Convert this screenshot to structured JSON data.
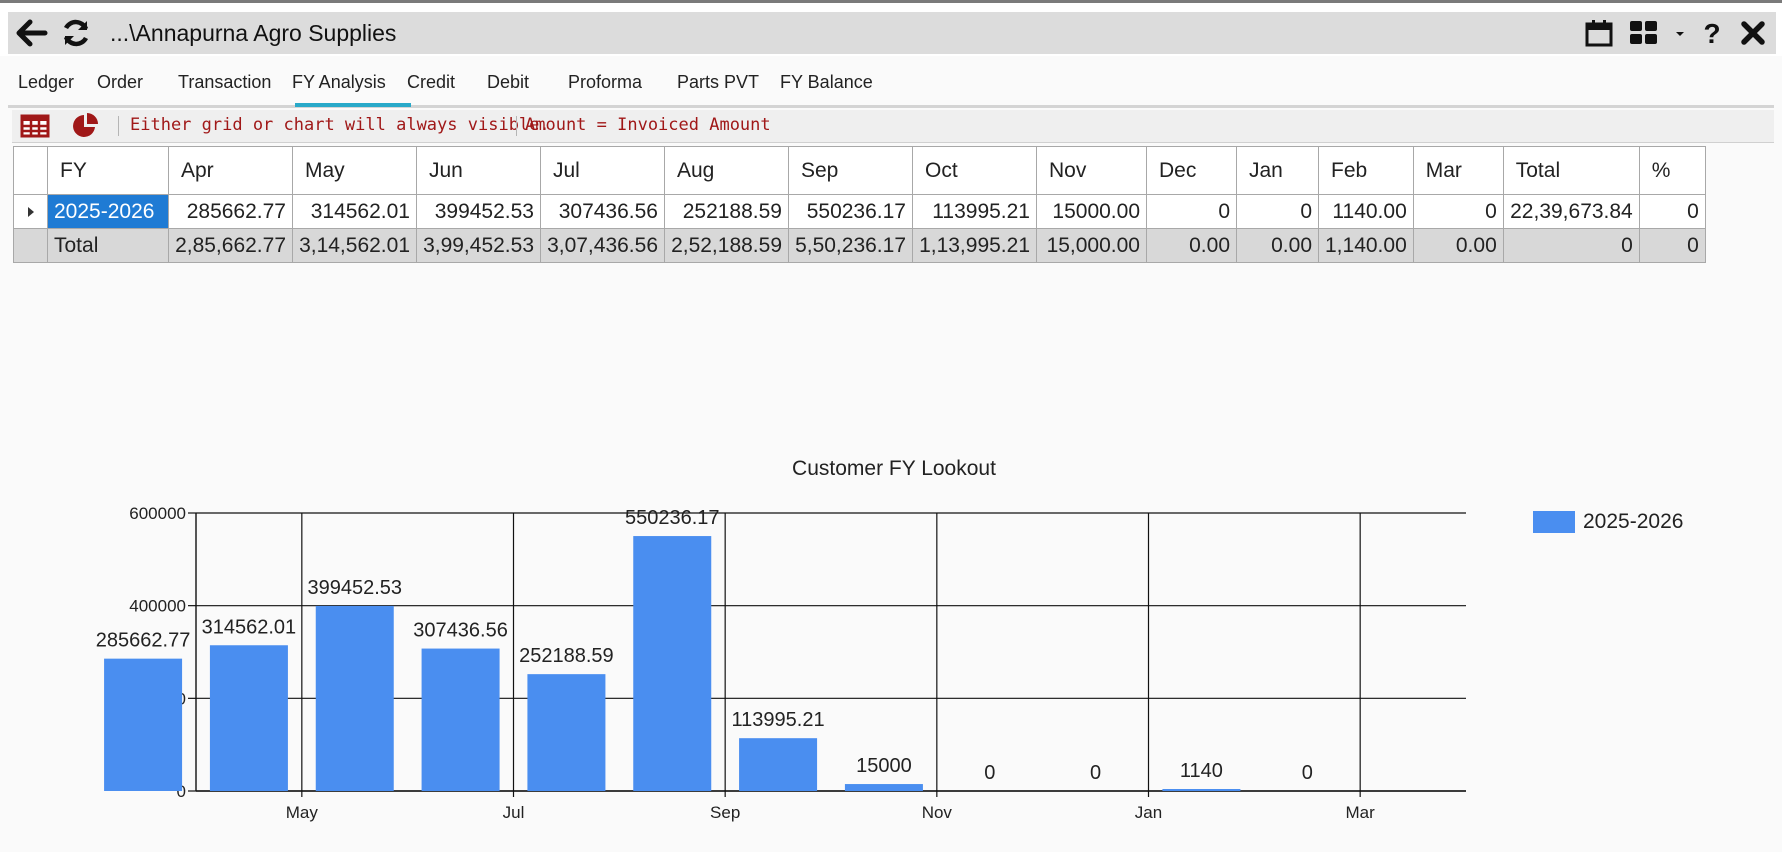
{
  "window": {
    "title": "...\\Annapurna Agro Supplies",
    "icons": [
      "back-arrow-icon",
      "refresh-icon",
      "calendar-icon",
      "grid-layout-icon",
      "dropdown-arrow-icon",
      "help-icon",
      "close-icon"
    ]
  },
  "tabs": [
    {
      "label": "Ledger"
    },
    {
      "label": "Order"
    },
    {
      "label": "Transaction"
    },
    {
      "label": "FY Analysis",
      "active": true
    },
    {
      "label": "Credit"
    },
    {
      "label": "Debit"
    },
    {
      "label": "Proforma"
    },
    {
      "label": "Parts PVT"
    },
    {
      "label": "FY Balance"
    }
  ],
  "toolbar": {
    "msg1": "Either grid or chart will always visible.",
    "msg2": "Amount = Invoiced Amount"
  },
  "grid": {
    "headers": [
      "FY",
      "Apr",
      "May",
      "Jun",
      "Jul",
      "Aug",
      "Sep",
      "Oct",
      "Nov",
      "Dec",
      "Jan",
      "Feb",
      "Mar",
      "Total",
      "%"
    ],
    "row": [
      "2025-2026",
      "285662.77",
      "314562.01",
      "399452.53",
      "307436.56",
      "252188.59",
      "550236.17",
      "113995.21",
      "15000.00",
      "0",
      "0",
      "1140.00",
      "0",
      "22,39,673.84",
      "0"
    ],
    "total": [
      "Total",
      "2,85,662.77",
      "3,14,562.01",
      "3,99,452.53",
      "3,07,436.56",
      "2,52,188.59",
      "5,50,236.17",
      "1,13,995.21",
      "15,000.00",
      "0.00",
      "0.00",
      "1,140.00",
      "0.00",
      "0",
      "0"
    ]
  },
  "colors": {
    "bar": "#4a8ef0",
    "accent": "#29a9c9",
    "selected": "#1f7bd4",
    "message": "#a01818"
  },
  "chart_data": {
    "type": "bar",
    "title": "Customer FY Lookout",
    "categories": [
      "Apr",
      "May",
      "Jun",
      "Jul",
      "Aug",
      "Sep",
      "Oct",
      "Nov",
      "Dec",
      "Jan",
      "Feb",
      "Mar"
    ],
    "x_tick_labels": [
      "May",
      "Jul",
      "Sep",
      "Nov",
      "Jan",
      "Mar"
    ],
    "series": [
      {
        "name": "2025-2026",
        "values": [
          285662.77,
          314562.01,
          399452.53,
          307436.56,
          252188.59,
          550236.17,
          113995.21,
          15000,
          0,
          0,
          1140,
          0
        ]
      }
    ],
    "data_labels": [
      "285662.77",
      "314562.01",
      "399452.53",
      "307436.56",
      "252188.59",
      "550236.17",
      "113995.21",
      "15000",
      "0",
      "0",
      "1140",
      "0"
    ],
    "y_ticks": [
      "0",
      "200000",
      "400000",
      "600000"
    ],
    "ylim": [
      0,
      600000
    ],
    "grid": true,
    "legend": "right"
  }
}
